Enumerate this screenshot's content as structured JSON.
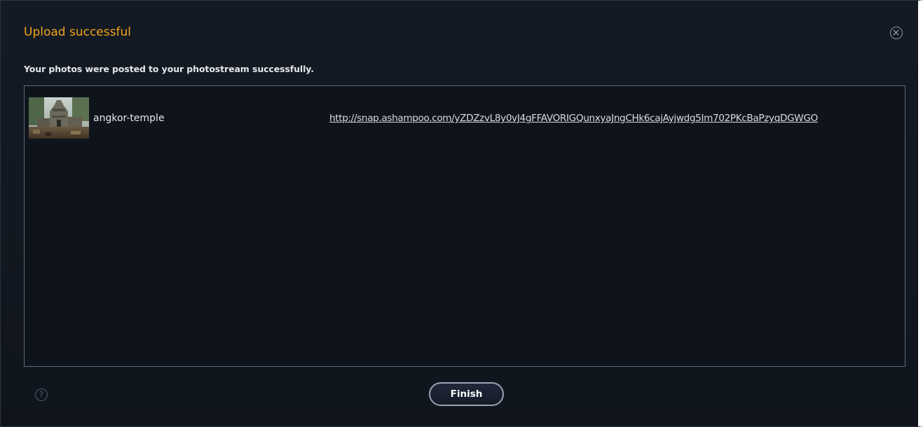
{
  "dialog": {
    "title": "Upload successful",
    "message": "Your photos were posted to your photostream successfully.",
    "close_icon": "close-circle-icon",
    "help_icon": "question-circle-icon",
    "help_glyph": "?",
    "finish_label": "Finish"
  },
  "uploads": [
    {
      "name": "angkor-temple",
      "url": "http://snap.ashampoo.com/yZDZzvL8y0vJ4gFFAVORIGQunxyaJngCHk6cajAyjwdg5Im702PKcBaPzyqDGWGO"
    }
  ],
  "colors": {
    "title_accent": "#f0a418",
    "background": "#121821",
    "panel_border": "#5d6b7c"
  }
}
